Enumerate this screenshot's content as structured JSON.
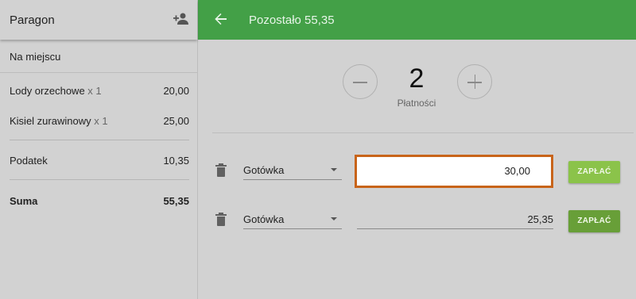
{
  "receipt": {
    "title": "Paragon",
    "place": "Na miejscu",
    "items": [
      {
        "name": "Lody orzechowe",
        "qty": "x 1",
        "price": "20,00"
      },
      {
        "name": "Kisiel zurawinowy",
        "qty": "x 1",
        "price": "25,00"
      }
    ],
    "tax_label": "Podatek",
    "tax_value": "10,35",
    "total_label": "Suma",
    "total_value": "55,35"
  },
  "topbar": {
    "title": "Pozostało 55,35",
    "color": "#43a047"
  },
  "payments": {
    "count": "2",
    "count_label": "Płatności",
    "rows": [
      {
        "method": "Gotówka",
        "amount": "30,00",
        "button": "ZAPŁAĆ"
      },
      {
        "method": "Gotówka",
        "amount": "25,35",
        "button": "ZAPŁAĆ"
      }
    ]
  },
  "icons": {
    "add_person": "person-add-icon",
    "back": "arrow-back-icon",
    "delete": "trash-icon",
    "decrease": "minus-icon",
    "increase": "plus-icon",
    "dropdown": "caret-down-icon"
  },
  "colors": {
    "accent": "#43a047",
    "button_active": "#8bc34a",
    "button_inactive": "#689f38",
    "focus_border": "#c8641a"
  }
}
